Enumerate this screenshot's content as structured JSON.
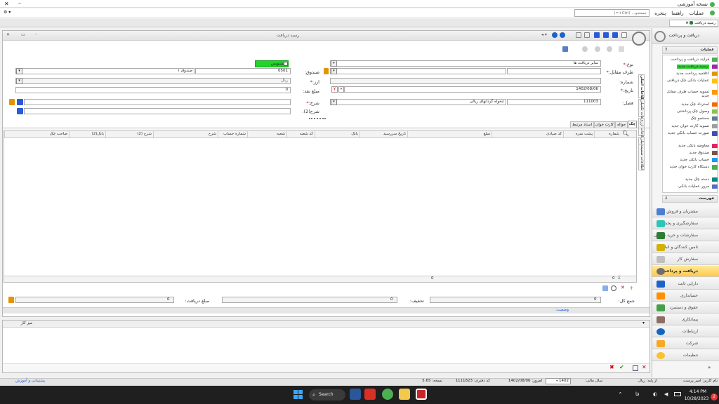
{
  "app": {
    "title": "نسخه آموزشی"
  },
  "menubar": {
    "items": [
      "عملیات",
      "راهنما",
      "پنجره"
    ],
    "search_placeholder": "جستجو... (Ctrl+=)"
  },
  "doc_tab": {
    "label": "رسید دریافت"
  },
  "form_window": {
    "title": "رسید دریافت"
  },
  "form": {
    "type_label": "نوع:",
    "type_value": "سایر دریافت ها",
    "party_label": "طرف مقابل:",
    "party_value": "",
    "number_label": "شماره:",
    "number_value": "",
    "date_label": "تاریخ:",
    "date_value": "1402/08/06",
    "category_label": "فصل:",
    "category_code": "111003",
    "category_value": "تنخواه گردانهای ریالی",
    "fund_label": "صندوق:",
    "fund_code": "0501",
    "fund_name": "صندوق ۱",
    "currency_label": "ارز:",
    "currency_value": "ریال",
    "cash_label": "مبلغ نقد:",
    "cash_value": "0",
    "desc_label": "شرح:",
    "desc_value": "",
    "desc2_label": "شرح(2):",
    "desc2_value": "",
    "draft_label": "پیشنویس"
  },
  "vtabs": [
    "اطلاعات اصلی",
    "اطلاعات تکمیلی",
    "اطلاعات ارزی",
    "اطلاعات تکمیلی",
    "اطلاعات ضمیمه"
  ],
  "subtabs": [
    "چک",
    "حواله",
    "کارت خوان",
    "اسناد مرتبط"
  ],
  "table": {
    "columns": [
      "شماره",
      "پشت نمره",
      "کد صیادی",
      "مبلغ",
      "تاریخ سررسید",
      "بانک",
      "کد شعبه",
      "شعبه",
      "شماره حساب",
      "شرح",
      "شرح (2)",
      "بانک(2)",
      "صاحب چک"
    ],
    "footer_count": "0",
    "footer_sum": "0"
  },
  "totals": {
    "total_label": "جمع کل:",
    "total_value": "0",
    "discount_label": "تخفیف:",
    "discount_value": "0",
    "received_label": "مبلغ دریافت:",
    "received_value": "0",
    "status_label": "وضعیت:"
  },
  "notes": {
    "title": "میز کار"
  },
  "sidebar": {
    "header": "دریافت و پرداخت",
    "ops_title": "عملیات",
    "ops": [
      "فرآیند دریافت و پرداخت",
      "رسید دریافت جدید",
      "اعلامیه پرداخت جدید",
      "عملیات بانکی چک دریافتی",
      "تسویه حساب طرف مقابل جدید",
      "استرداد چک جدید",
      "وصول چک پرداختنی",
      "جستجو چک",
      "تسویه کارت خوان جدید",
      "صورت حساب بانکی جدید",
      "معاوضه بانکی جدید",
      "صندوق جدید",
      "حساب بانکی جدید",
      "دستگاه کارت خوان جدید",
      "دسته چک جدید",
      "مرور عملیات بانکی"
    ],
    "list_title": "فهرست",
    "nav": [
      "مشتریان و فروش",
      "سفارشگیری و پخش",
      "سفارشات و خرید خارجی",
      "تامین کنندگان و انبار",
      "سفارش کار",
      "دریافت و پرداخت",
      "دارایی ثابت",
      "حسابداری",
      "حقوق و دستمزد",
      "پیمانکاری",
      "ارتباطات",
      "شرکت",
      "تنظیمات"
    ]
  },
  "statusbar": {
    "user": "نام کاربر: امیر پرست",
    "fiscal_label": "از پایه:",
    "fiscal_unit": "ریال",
    "year_label": "سال مالی:",
    "year_value": "1402",
    "today_label": "امروز:",
    "today_value": "1402/08/06",
    "code_label": "کد دفتری:",
    "code_value": "1111823",
    "version_label": "نسخه:",
    "version_value": "5.65",
    "support": "پشتیبانی و آموزش"
  },
  "taskbar": {
    "search": "Search",
    "time": "4:14 PM",
    "date": "10/28/2023",
    "badge": "2"
  }
}
